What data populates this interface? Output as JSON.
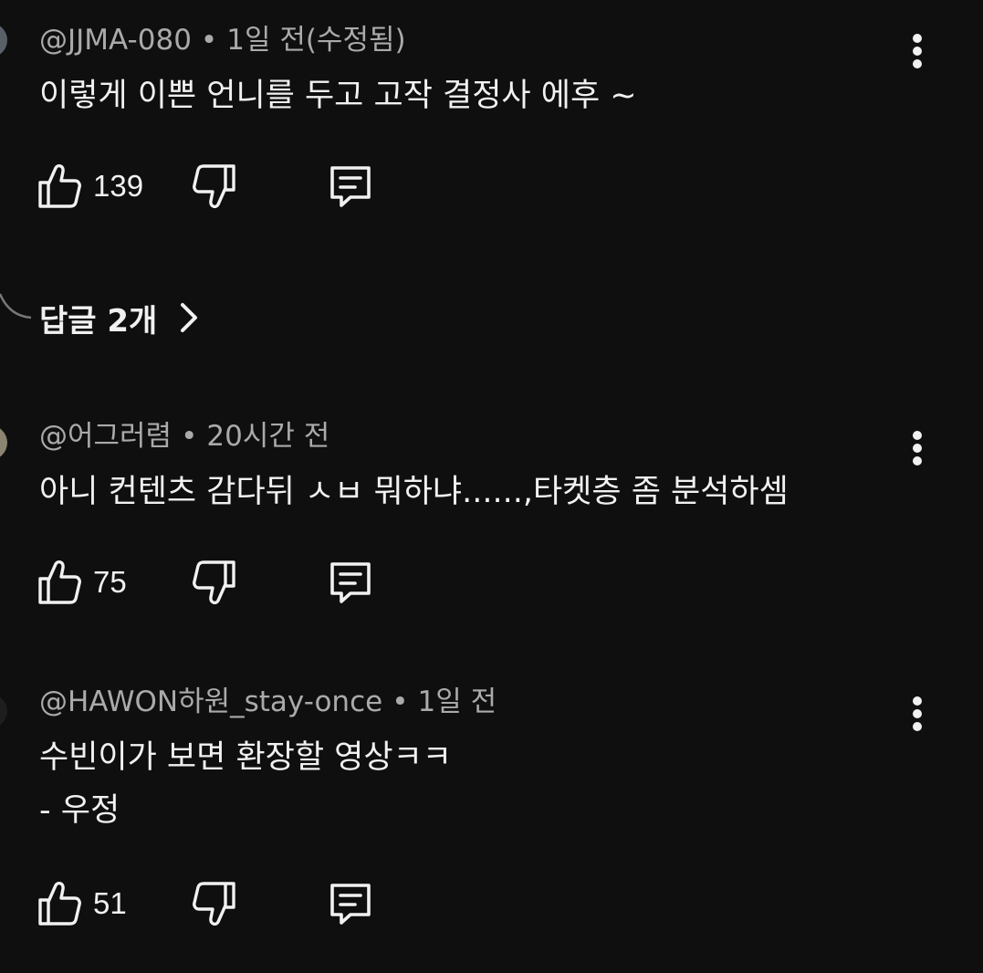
{
  "comments": [
    {
      "author": "@JJMA-080",
      "time": "1일 전(수정됨)",
      "text_lines": [
        "이렇게 이쁜 언니를 두고 고작 결정사 에후 ~"
      ],
      "likes": "139",
      "replies_label": "답글 2개"
    },
    {
      "author": "@어그러렴",
      "time": "20시간 전",
      "text_lines": [
        "아니 컨텐츠 감다뒤 ㅅㅂ 뭐하냐......,타켓층 좀 분석하셈"
      ],
      "likes": "75"
    },
    {
      "author": "@HAWON하원_stay-once",
      "time": "1일 전",
      "text_lines": [
        "수빈이가 보면 환장할 영상ㅋㅋ",
        "- 우정"
      ],
      "likes": "51"
    }
  ],
  "separator": "•",
  "icons": {
    "like": "thumbs-up-icon",
    "dislike": "thumbs-down-icon",
    "reply": "comment-reply-icon",
    "more": "more-vertical-icon",
    "chevron": "chevron-right-icon"
  },
  "colors": {
    "background": "#0f0f0f",
    "primary_text": "#f1f1f1",
    "secondary_text": "#aaaaaa"
  }
}
